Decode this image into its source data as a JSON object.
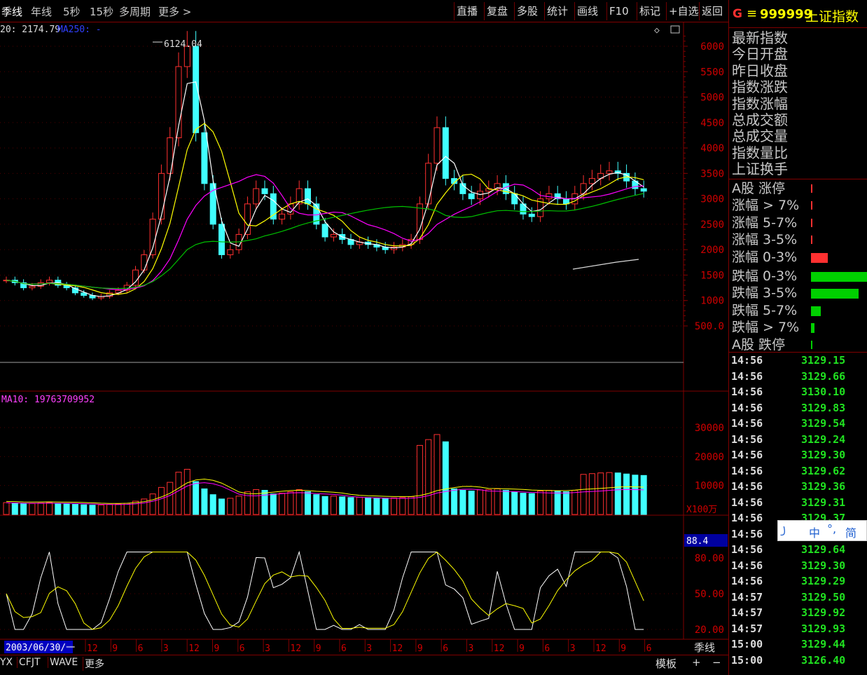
{
  "toolbar": {
    "period_tabs": [
      "季线",
      "年线",
      "5秒",
      "15秒",
      "多周期",
      "更多 >"
    ],
    "right_tabs": [
      "直播",
      "复盘",
      "多股",
      "统计",
      "画线",
      "F10",
      "标记",
      "+自选",
      "返回"
    ]
  },
  "main_chart": {
    "ma_label": "20: 2174.79",
    "ma250_label": "MA250: -",
    "peak_label": "6124.04",
    "y_ticks": [
      "6000",
      "5500",
      "5000",
      "4500",
      "4000",
      "3500",
      "3000",
      "2500",
      "2000",
      "1500",
      "1000",
      "500.0"
    ]
  },
  "volume_chart": {
    "ma_label": "MA10: 19763709952",
    "y_ticks": [
      "30000",
      "20000",
      "10000"
    ],
    "unit": "X100万"
  },
  "indicator_chart": {
    "current": "88.4",
    "y_ticks": [
      "80.00",
      "50.00",
      "20.00"
    ]
  },
  "time_axis": {
    "start_label": "2003/06/30/一",
    "labels": [
      "12",
      "9",
      "6",
      "3",
      "12",
      "9",
      "6",
      "3",
      "12",
      "9",
      "6",
      "3",
      "12",
      "9",
      "6",
      "3",
      "12",
      "9",
      "6",
      "3",
      "12",
      "9",
      "6"
    ],
    "period": "季线"
  },
  "bottom_bar": {
    "tabs": [
      "YX",
      "CFJT",
      "WAVE",
      "更多"
    ],
    "right_items": [
      "模板",
      "+",
      "−"
    ]
  },
  "quote_panel": {
    "badge": "G",
    "code": "999999",
    "name": "上证指数",
    "fields": [
      "最新指数",
      "今日开盘",
      "昨日收盘",
      "指数涨跌",
      "指数涨幅",
      "总成交额",
      "总成交量",
      "指数量比",
      "上证换手"
    ],
    "breadth": [
      {
        "label": "A股 涨停",
        "kind": "up",
        "value": 0.01
      },
      {
        "label": "涨幅 > 7%",
        "kind": "up",
        "value": 0.01
      },
      {
        "label": "涨幅 5-7%",
        "kind": "up",
        "value": 0.01
      },
      {
        "label": "涨幅 3-5%",
        "kind": "up",
        "value": 0.03
      },
      {
        "label": "涨幅 0-3%",
        "kind": "up",
        "value": 0.3
      },
      {
        "label": "跌幅 0-3%",
        "kind": "down",
        "value": 1.0
      },
      {
        "label": "跌幅 3-5%",
        "kind": "down",
        "value": 0.85
      },
      {
        "label": "跌幅 5-7%",
        "kind": "down",
        "value": 0.18
      },
      {
        "label": "跌幅 > 7%",
        "kind": "down",
        "value": 0.06
      },
      {
        "label": "A股 跌停",
        "kind": "down",
        "value": 0.01
      }
    ],
    "ticks": [
      {
        "time": "14:56",
        "value": "3129.15"
      },
      {
        "time": "14:56",
        "value": "3129.66"
      },
      {
        "time": "14:56",
        "value": "3130.10"
      },
      {
        "time": "14:56",
        "value": "3129.83"
      },
      {
        "time": "14:56",
        "value": "3129.54"
      },
      {
        "time": "14:56",
        "value": "3129.24"
      },
      {
        "time": "14:56",
        "value": "3129.30"
      },
      {
        "time": "14:56",
        "value": "3129.62"
      },
      {
        "time": "14:56",
        "value": "3129.36"
      },
      {
        "time": "14:56",
        "value": "3129.31"
      },
      {
        "time": "14:56",
        "value": "3129.37"
      },
      {
        "time": "14:56",
        "value": ""
      },
      {
        "time": "14:56",
        "value": "3129.64"
      },
      {
        "time": "14:56",
        "value": "3129.30"
      },
      {
        "time": "14:56",
        "value": "3129.29"
      },
      {
        "time": "14:57",
        "value": "3129.50"
      },
      {
        "time": "14:57",
        "value": "3129.92"
      },
      {
        "time": "14:57",
        "value": "3129.93"
      },
      {
        "time": "15:00",
        "value": "3129.44"
      },
      {
        "time": "15:00",
        "value": "3126.40"
      }
    ]
  },
  "ime_toolbar": {
    "lang": "中",
    "punct": "°,",
    "mode": "简"
  },
  "colors": {
    "up": "#ff3030",
    "down": "#40ffff",
    "axis": "#800000",
    "ma_white": "#ffffff",
    "ma_yellow": "#ffff00",
    "ma_magenta": "#ff00ff",
    "ma_green": "#00c000"
  }
}
